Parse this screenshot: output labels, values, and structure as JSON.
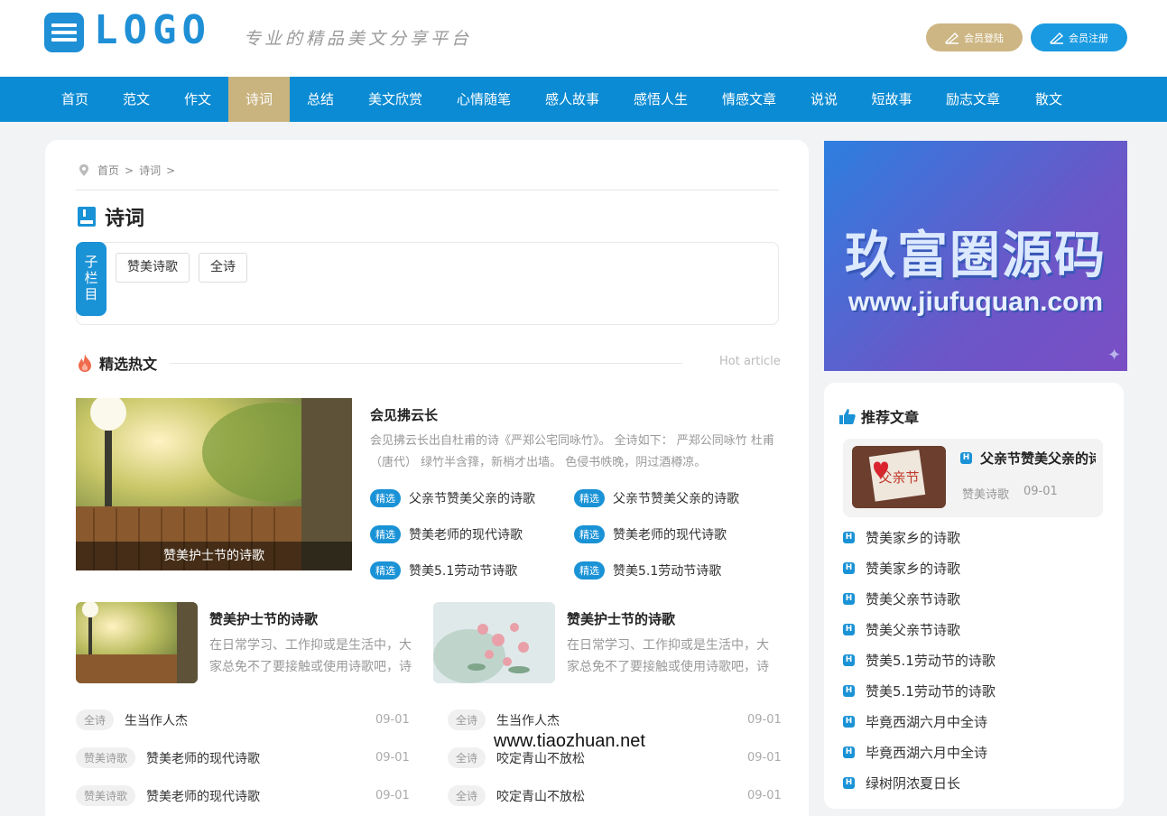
{
  "header": {
    "logo_text": "LOGO",
    "slogan": "专业的精品美文分享平台",
    "login_label": "会员登陆",
    "register_label": "会员注册"
  },
  "nav": [
    "首页",
    "范文",
    "作文",
    "诗词",
    "总结",
    "美文欣赏",
    "心情随笔",
    "感人故事",
    "感悟人生",
    "情感文章",
    "说说",
    "短故事",
    "励志文章",
    "散文"
  ],
  "nav_active": "诗词",
  "breadcrumb": {
    "home": "首页",
    "sep": ">",
    "current": "诗词",
    "tail": ">"
  },
  "page_title": "诗词",
  "subcolumns": {
    "label": "子栏目",
    "items": [
      "赞美诗歌",
      "全诗"
    ]
  },
  "hot": {
    "title": "精选热文",
    "subtitle": "Hot article"
  },
  "featured": {
    "caption": "赞美护士节的诗歌",
    "title": "会见拂云长",
    "desc": "会见拂云长出自杜甫的诗《严郑公宅同咏竹》。 全诗如下： 严郑公同咏竹 杜甫（唐代） 绿竹半含箨，新梢才出墙。 色侵书帙晚，阴过酒樽凉。",
    "pick_tag": "精选",
    "picks": [
      "父亲节赞美父亲的诗歌",
      "父亲节赞美父亲的诗歌",
      "赞美老师的现代诗歌",
      "赞美老师的现代诗歌",
      "赞美5.1劳动节诗歌",
      "赞美5.1劳动节诗歌"
    ]
  },
  "mini_articles": [
    {
      "title": "赞美护士节的诗歌",
      "desc": "在日常学习、工作抑或是生活中，大家总免不了要接触或使用诗歌吧，诗歌是一种抒情言志的文学体裁"
    },
    {
      "title": "赞美护士节的诗歌",
      "desc": "在日常学习、工作抑或是生活中，大家总免不了要接触或使用诗歌吧，诗歌是一种抒情言志的文学体裁"
    }
  ],
  "list_left": [
    {
      "cat": "全诗",
      "title": "生当作人杰",
      "date": "09-01"
    },
    {
      "cat": "赞美诗歌",
      "title": "赞美老师的现代诗歌",
      "date": "09-01"
    },
    {
      "cat": "赞美诗歌",
      "title": "赞美老师的现代诗歌",
      "date": "09-01"
    }
  ],
  "list_right": [
    {
      "cat": "全诗",
      "title": "生当作人杰",
      "date": "09-01"
    },
    {
      "cat": "全诗",
      "title": "咬定青山不放松",
      "date": "09-01"
    },
    {
      "cat": "全诗",
      "title": "咬定青山不放松",
      "date": "09-01"
    }
  ],
  "banner": {
    "line1": "玖富圈源码",
    "line2": "www.jiufuquan.com"
  },
  "sidebar": {
    "title": "推荐文章",
    "badge": "H",
    "featured": {
      "img_text": "父亲节",
      "title": "父亲节赞美父亲的诗歌",
      "cat": "赞美诗歌",
      "date": "09-01"
    },
    "items": [
      "赞美家乡的诗歌",
      "赞美家乡的诗歌",
      "赞美父亲节诗歌",
      "赞美父亲节诗歌",
      "赞美5.1劳动节的诗歌",
      "赞美5.1劳动节的诗歌",
      "毕竟西湖六月中全诗",
      "毕竟西湖六月中全诗",
      "绿树阴浓夏日长"
    ]
  },
  "watermark": "www.tiaozhuan.net",
  "colors": {
    "primary": "#0b8bd3",
    "gold": "#c9b37f",
    "bg": "#f2f3f5"
  }
}
